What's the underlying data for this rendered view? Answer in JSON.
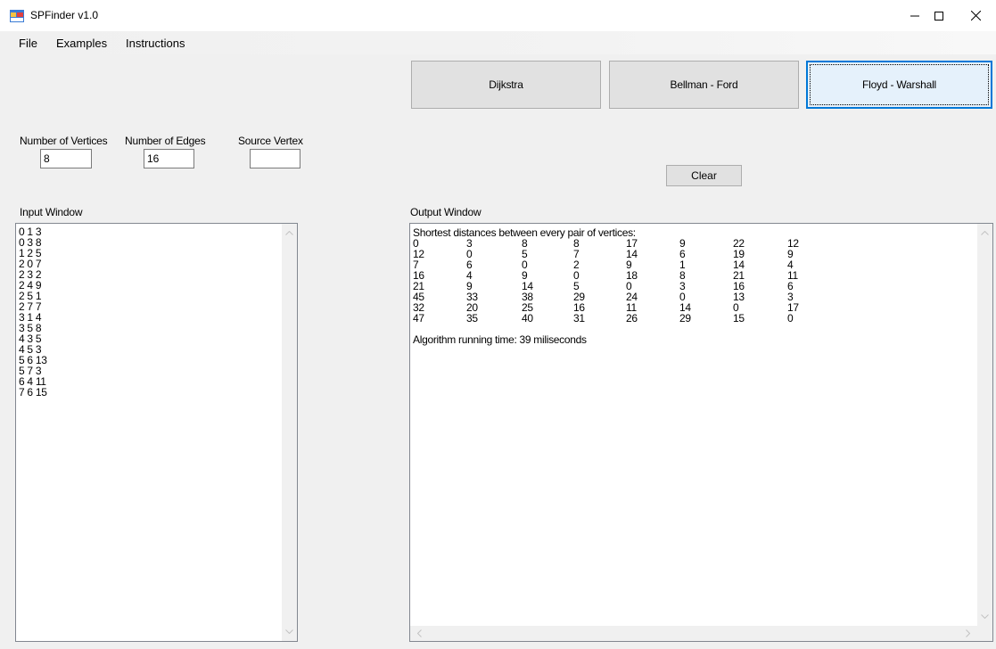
{
  "window": {
    "title": "SPFinder v1.0"
  },
  "menu": {
    "items": [
      "File",
      "Examples",
      "Instructions"
    ]
  },
  "algorithms": {
    "dijkstra": "Dijkstra",
    "bellman_ford": "Bellman - Ford",
    "floyd_warshall": "Floyd - Warshall"
  },
  "params": {
    "vertices_label": "Number of Vertices",
    "vertices_value": "8",
    "edges_label": "Number of Edges",
    "edges_value": "16",
    "source_label": "Source Vertex",
    "source_value": ""
  },
  "clear_label": "Clear",
  "input": {
    "label": "Input Window",
    "lines": [
      "0 1 3",
      "0 3 8",
      "1 2 5",
      "2 0 7",
      "2 3 2",
      "2 4 9",
      "2 5 1",
      "2 7 7",
      "3 1 4",
      "3 5 8",
      "4 3 5",
      "4 5 3",
      "5 6 13",
      "5 7 3",
      "6 4 11",
      "7 6 15"
    ]
  },
  "output": {
    "label": "Output Window",
    "heading": "Shortest distances between every pair of vertices:",
    "matrix": [
      [
        "0",
        "3",
        "8",
        "8",
        "17",
        "9",
        "22",
        "12"
      ],
      [
        "12",
        "0",
        "5",
        "7",
        "14",
        "6",
        "19",
        "9"
      ],
      [
        "7",
        "6",
        "0",
        "2",
        "9",
        "1",
        "14",
        "4"
      ],
      [
        "16",
        "4",
        "9",
        "0",
        "18",
        "8",
        "21",
        "11"
      ],
      [
        "21",
        "9",
        "14",
        "5",
        "0",
        "3",
        "16",
        "6"
      ],
      [
        "45",
        "33",
        "38",
        "29",
        "24",
        "0",
        "13",
        "3"
      ],
      [
        "32",
        "20",
        "25",
        "16",
        "11",
        "14",
        "0",
        "17"
      ],
      [
        "47",
        "35",
        "40",
        "31",
        "26",
        "29",
        "15",
        "0"
      ]
    ],
    "running_time": "Algorithm running time: 39 miliseconds"
  }
}
